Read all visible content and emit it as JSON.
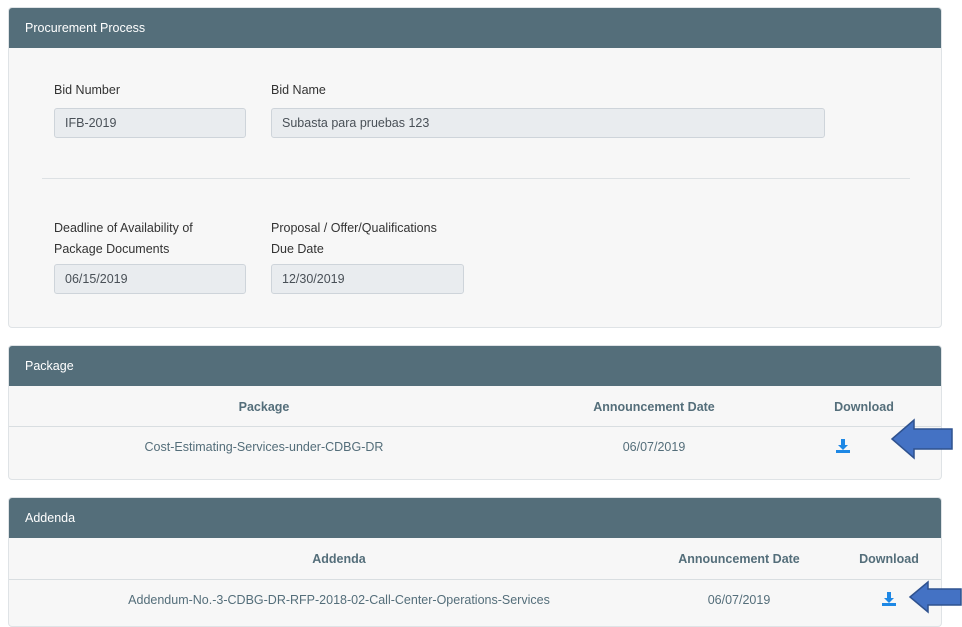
{
  "procurement": {
    "header": "Procurement Process",
    "bid_number_label": "Bid Number",
    "bid_number_value": "IFB-2019",
    "bid_name_label": "Bid Name",
    "bid_name_value": "Subasta para pruebas 123",
    "deadline_label_line1": "Deadline of Availability of",
    "deadline_label_line2": "Package Documents",
    "deadline_value": "06/15/2019",
    "due_label_line1": "Proposal / Offer/Qualifications",
    "due_label_line2": "Due Date",
    "due_value": "12/30/2019"
  },
  "package": {
    "header": "Package",
    "columns": [
      "Package",
      "Announcement Date",
      "Download"
    ],
    "rows": [
      {
        "name": "Cost-Estimating-Services-under-CDBG-DR",
        "date": "06/07/2019"
      }
    ]
  },
  "addenda": {
    "header": "Addenda",
    "columns": [
      "Addenda",
      "Announcement Date",
      "Download"
    ],
    "rows": [
      {
        "name": "Addendum-No.-3-CDBG-DR-RFP-2018-02-Call-Center-Operations-Services",
        "date": "06/07/2019"
      }
    ]
  },
  "colors": {
    "header_bg": "#546e7a",
    "download_icon": "#1e88e5",
    "arrow_fill": "#4472c4",
    "arrow_stroke": "#2f528f"
  }
}
